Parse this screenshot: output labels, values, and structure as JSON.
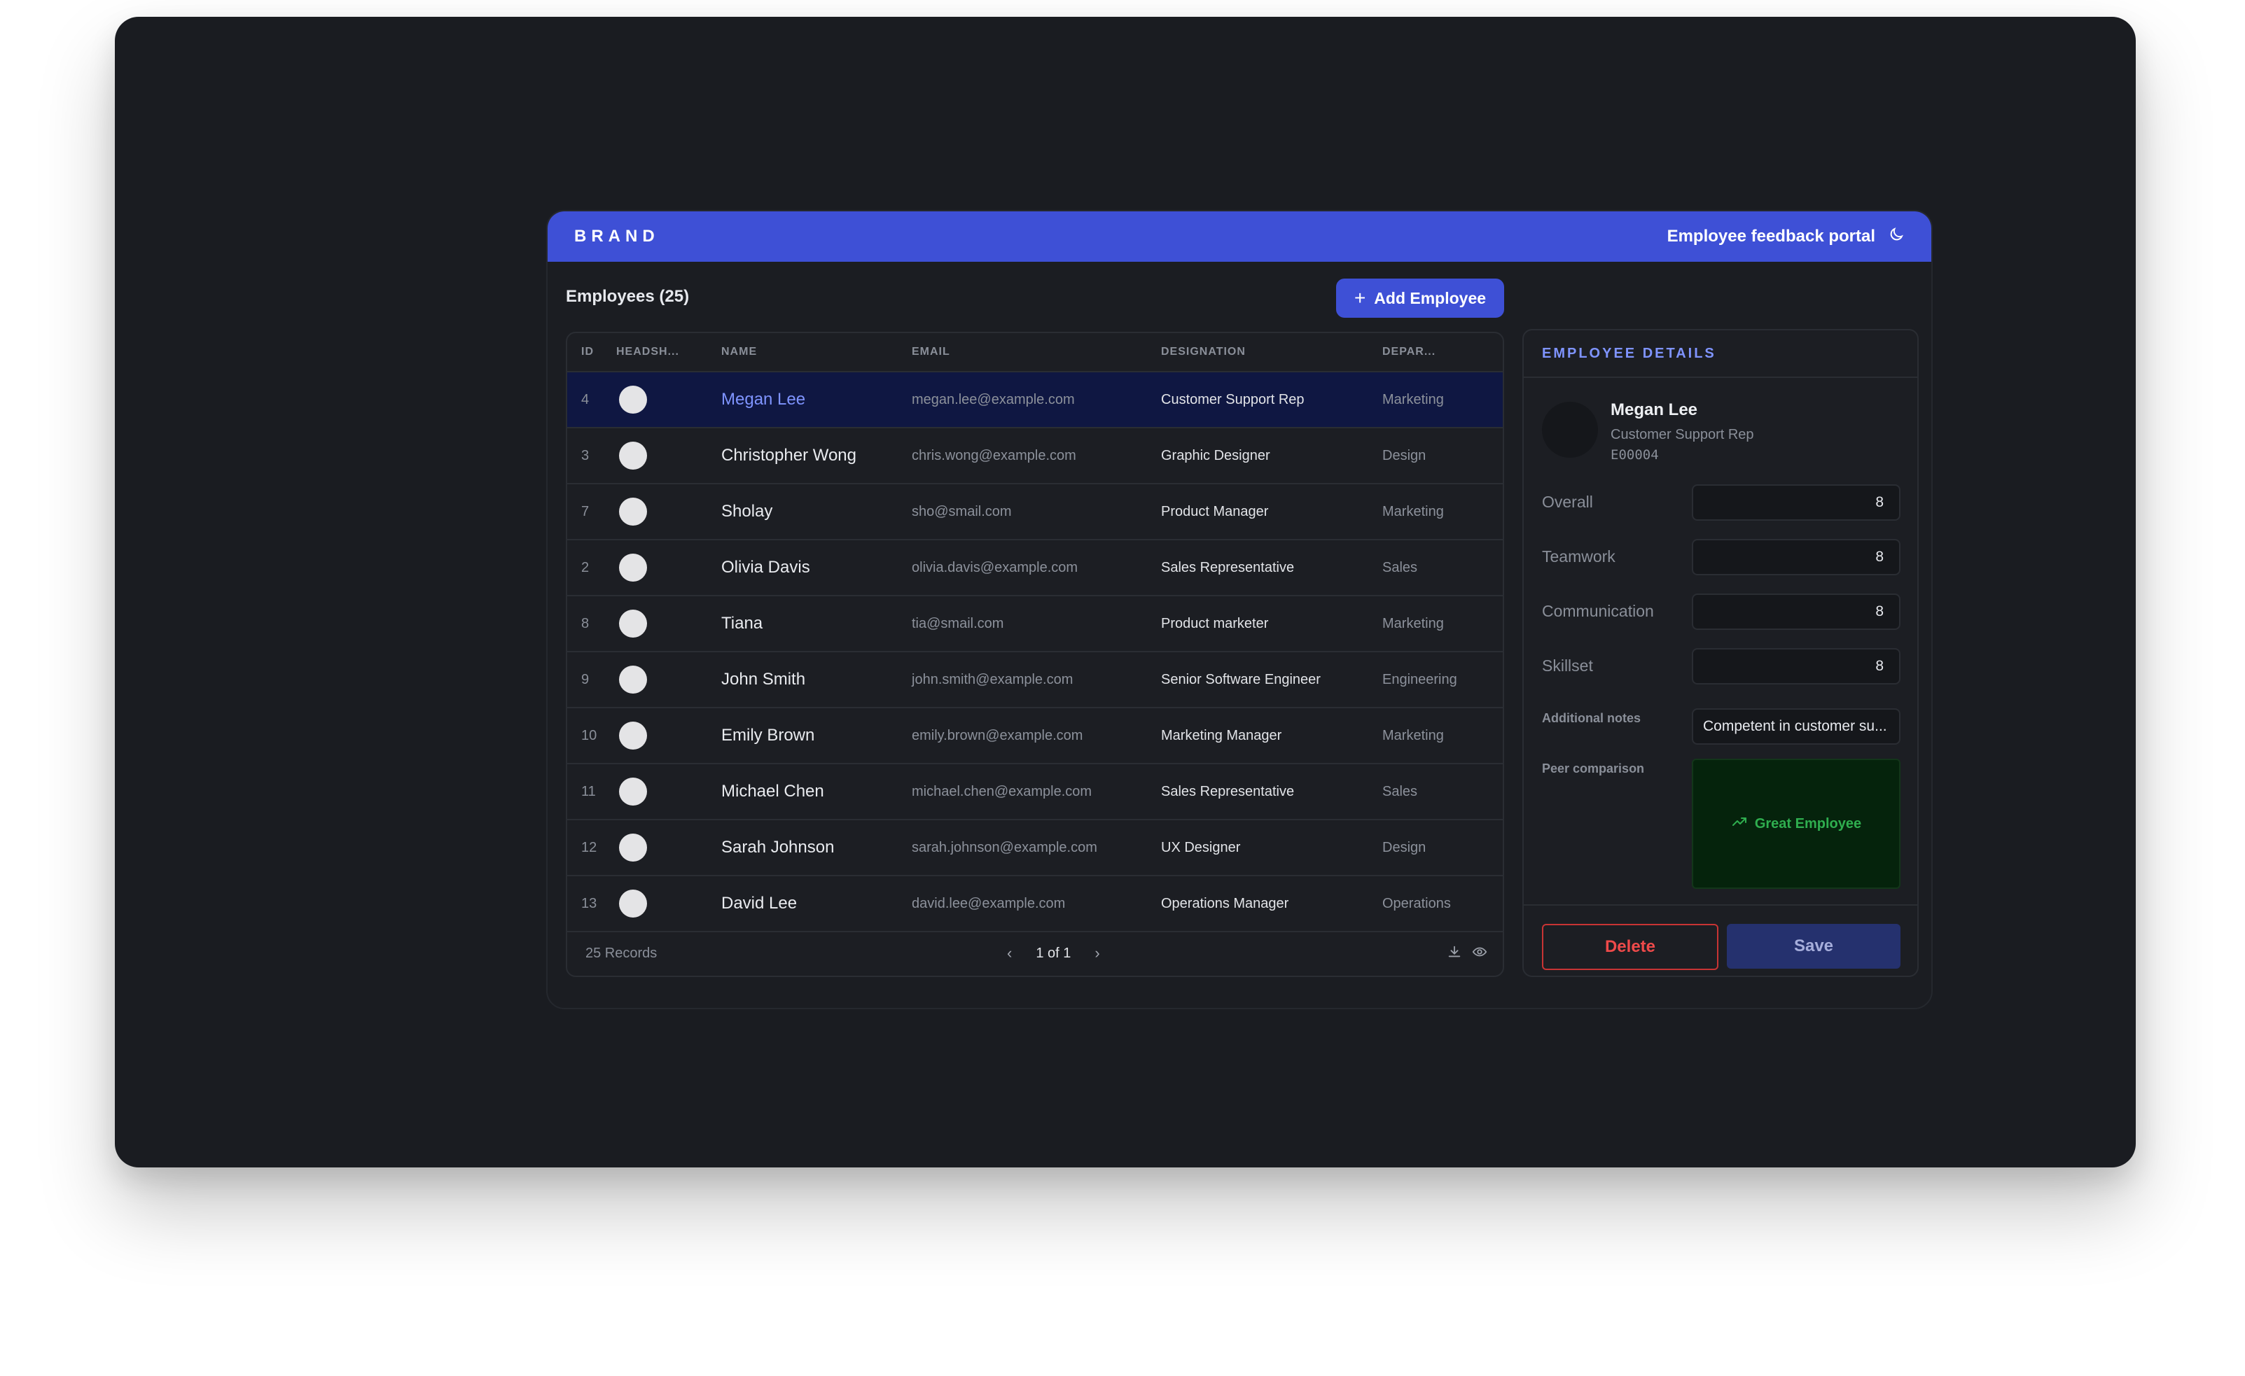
{
  "header": {
    "brand": "BRAND",
    "portal_title": "Employee feedback portal",
    "theme_icon": "moon-icon"
  },
  "employees": {
    "title": "Employees (25)",
    "add_button": "Add Employee"
  },
  "table": {
    "columns": [
      "ID",
      "HEADSH...",
      "NAME",
      "EMAIL",
      "DESIGNATION",
      "DEPAR..."
    ],
    "rows": [
      {
        "id": "4",
        "name": "Megan Lee",
        "email": "megan.lee@example.com",
        "designation": "Customer Support Rep",
        "department": "Marketing",
        "selected": true
      },
      {
        "id": "3",
        "name": "Christopher Wong",
        "email": "chris.wong@example.com",
        "designation": "Graphic Designer",
        "department": "Design"
      },
      {
        "id": "7",
        "name": "Sholay",
        "email": "sho@smail.com",
        "designation": "Product Manager",
        "department": "Marketing"
      },
      {
        "id": "2",
        "name": "Olivia Davis",
        "email": "olivia.davis@example.com",
        "designation": "Sales Representative",
        "department": "Sales"
      },
      {
        "id": "8",
        "name": "Tiana",
        "email": "tia@smail.com",
        "designation": "Product marketer",
        "department": "Marketing"
      },
      {
        "id": "9",
        "name": "John Smith",
        "email": "john.smith@example.com",
        "designation": "Senior Software Engineer",
        "department": "Engineering"
      },
      {
        "id": "10",
        "name": "Emily Brown",
        "email": "emily.brown@example.com",
        "designation": "Marketing Manager",
        "department": "Marketing"
      },
      {
        "id": "11",
        "name": "Michael Chen",
        "email": "michael.chen@example.com",
        "designation": "Sales Representative",
        "department": "Sales"
      },
      {
        "id": "12",
        "name": "Sarah Johnson",
        "email": "sarah.johnson@example.com",
        "designation": "UX Designer",
        "department": "Design"
      },
      {
        "id": "13",
        "name": "David Lee",
        "email": "david.lee@example.com",
        "designation": "Operations Manager",
        "department": "Operations"
      }
    ],
    "footer": {
      "records": "25 Records",
      "page": "1 of 1",
      "prev": "‹",
      "next": "›"
    }
  },
  "details": {
    "title": "EMPLOYEE DETAILS",
    "name": "Megan Lee",
    "role": "Customer Support Rep",
    "code": "E00004",
    "fields": [
      {
        "label": "Overall",
        "value": "8"
      },
      {
        "label": "Teamwork",
        "value": "8"
      },
      {
        "label": "Communication",
        "value": "8"
      },
      {
        "label": "Skillset",
        "value": "8"
      }
    ],
    "notes_label": "Additional notes",
    "notes_value": "Competent in customer su...",
    "peer_label": "Peer comparison",
    "peer_value": "Great Employee",
    "delete_label": "Delete",
    "save_label": "Save"
  },
  "colors": {
    "accent": "#3e50d6",
    "selected_row": "#0f1742",
    "danger": "#ef4a4a",
    "success": "#2fae4f"
  }
}
